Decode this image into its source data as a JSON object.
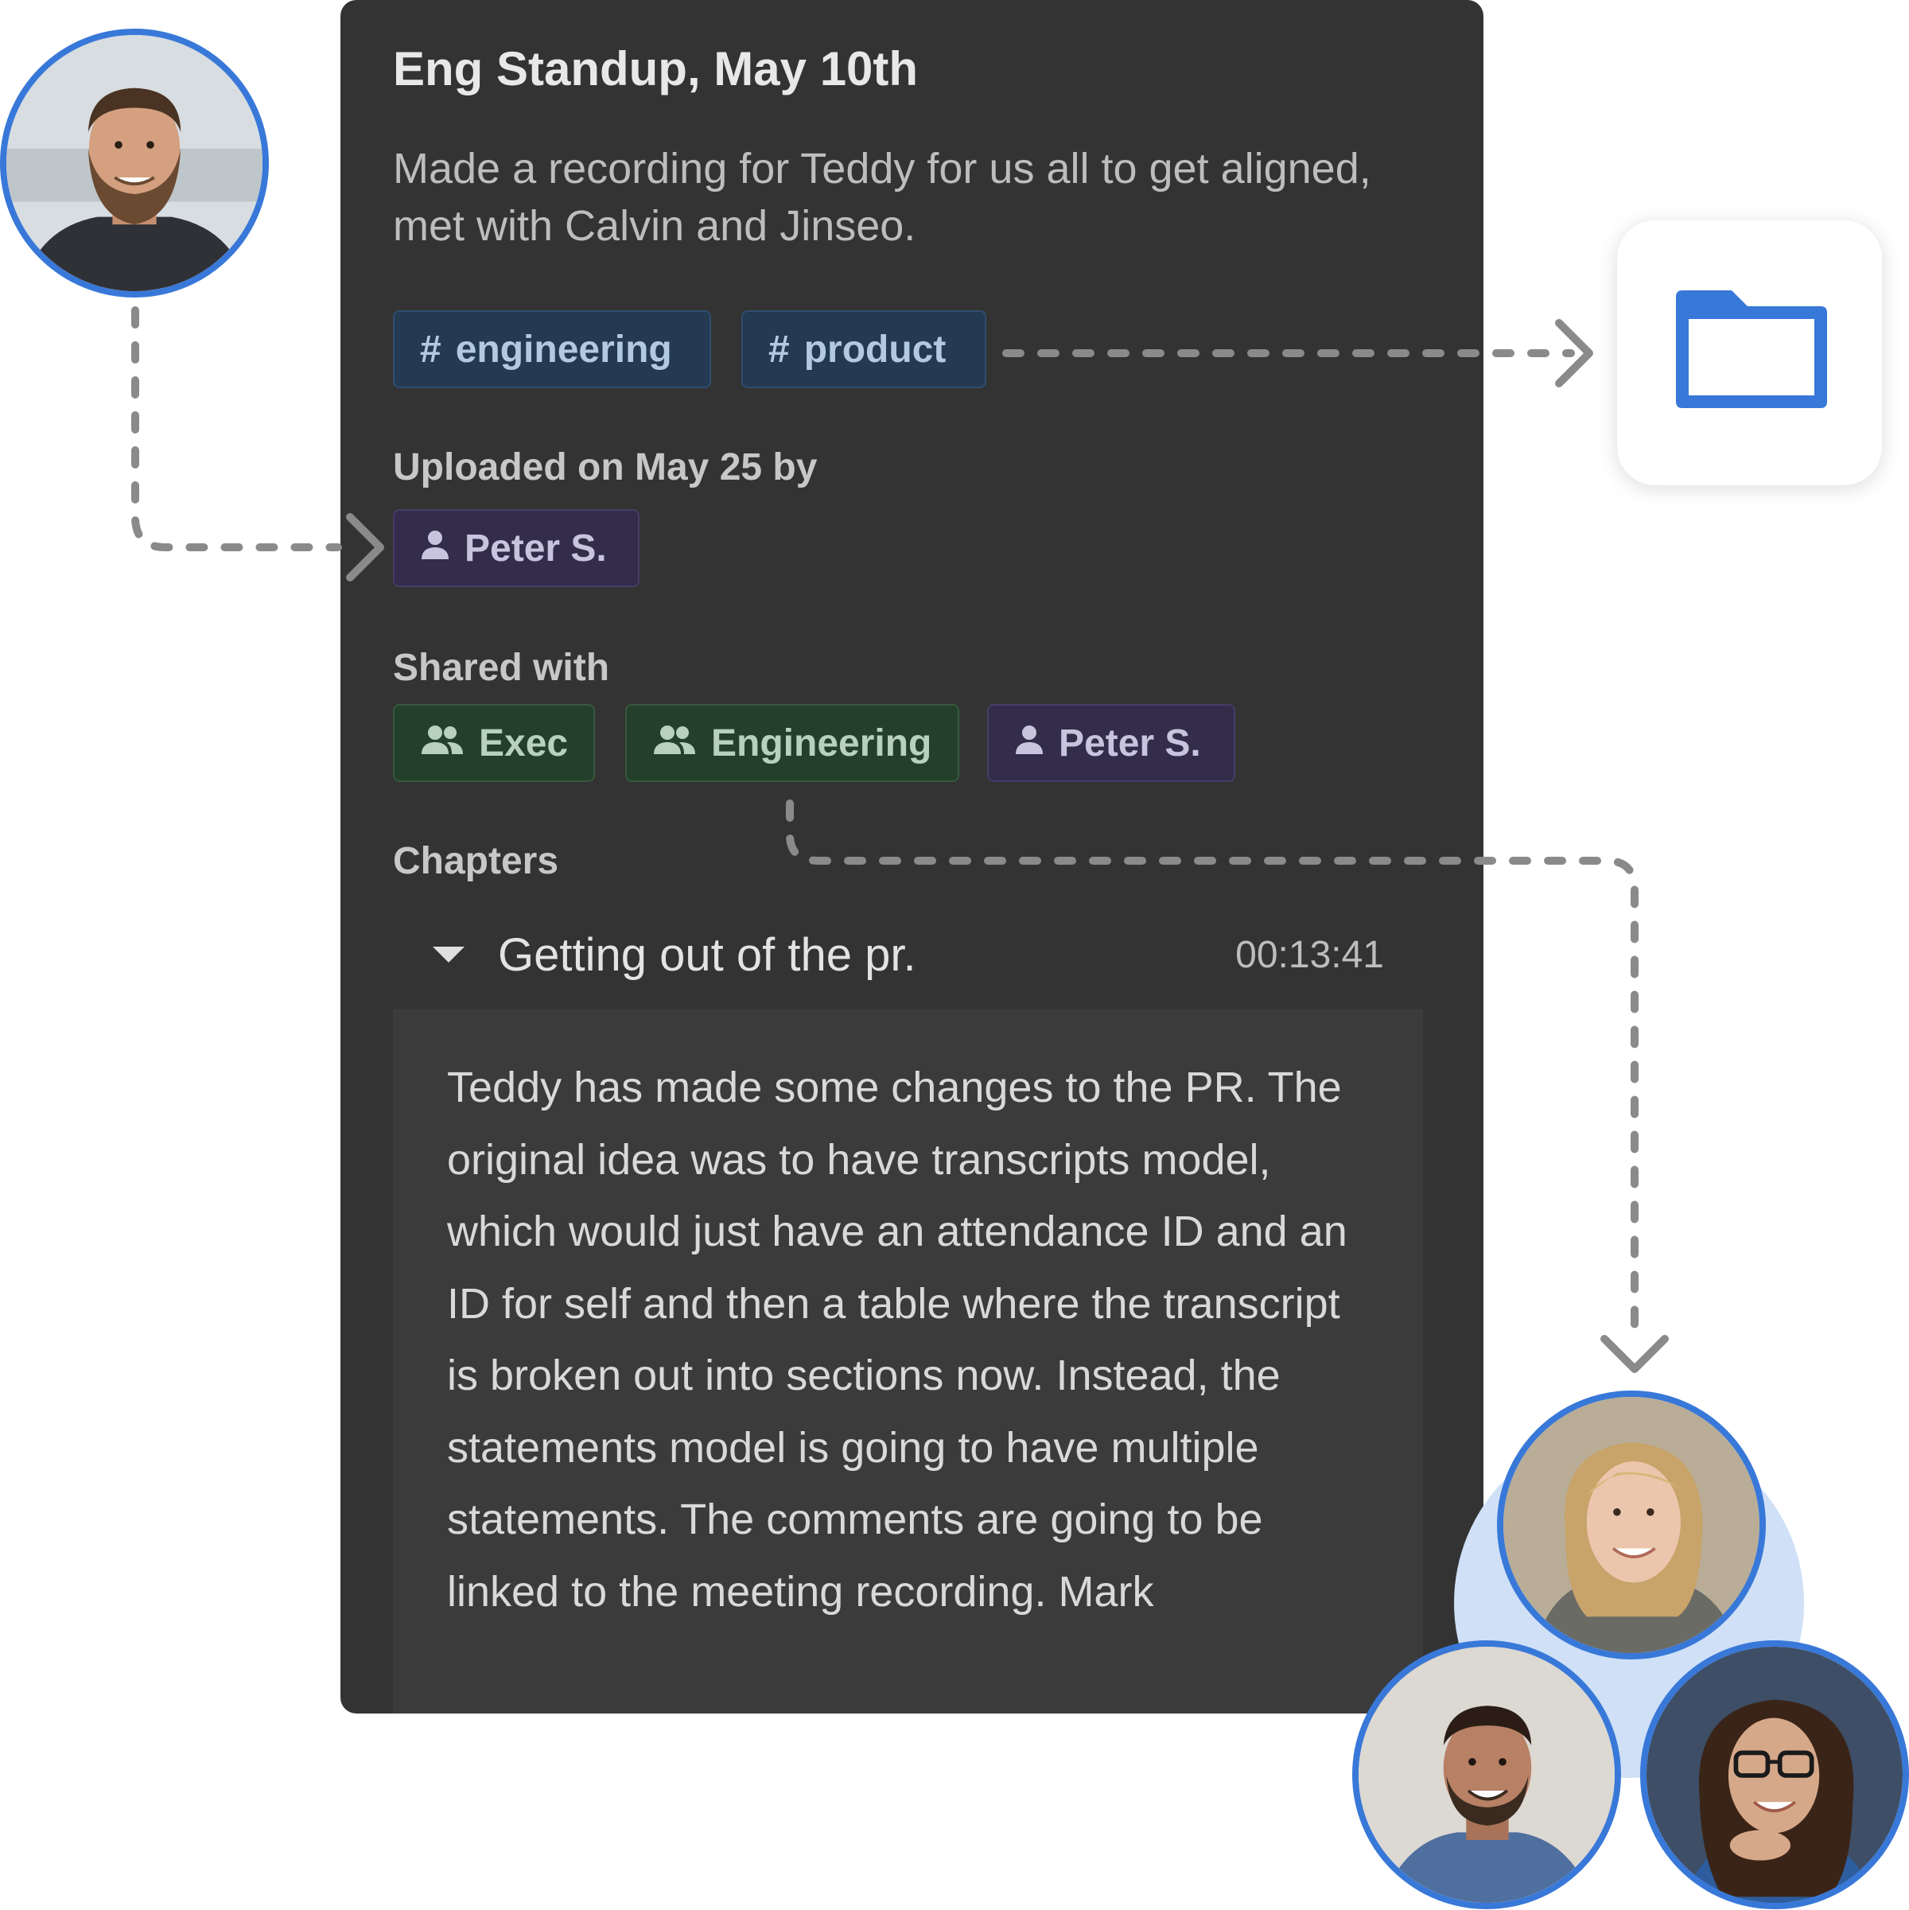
{
  "meeting": {
    "title": "Eng Standup, May 10th",
    "description": "Made a recording for Teddy for us all to get aligned, met with Calvin and Jinseo."
  },
  "tags": [
    {
      "symbol": "#",
      "label": "engineering"
    },
    {
      "symbol": "#",
      "label": "product"
    }
  ],
  "uploaded": {
    "label": "Uploaded on May 25 by",
    "by": "Peter S."
  },
  "shared": {
    "label": "Shared with",
    "items": [
      {
        "type": "group",
        "label": "Exec"
      },
      {
        "type": "group",
        "label": "Engineering"
      },
      {
        "type": "person",
        "label": "Peter S."
      }
    ]
  },
  "chapters": {
    "label": "Chapters",
    "items": [
      {
        "title": "Getting out of the pr.",
        "time": "00:13:41",
        "summary": "Teddy has made some changes to the PR. The original idea was to have transcripts model, which would just have an attendance ID and an ID for self and then a table where the transcript is broken out into sections now. Instead, the statements model is going to have multiple statements. The comments are going to be linked to the meeting recording. Mark"
      }
    ]
  },
  "colors": {
    "panel": "#333333",
    "accent_blue": "#3878d8",
    "tag_bg": "#233a52",
    "person_bg": "#332c4b",
    "group_bg": "#24402c",
    "connector": "#8a8a8a"
  },
  "icons": {
    "tag": "hash-icon",
    "person": "person-icon",
    "group": "group-icon",
    "chapter_toggle": "caret-down-icon",
    "folder": "folder-icon",
    "arrow": "chevron-arrow-icon"
  }
}
